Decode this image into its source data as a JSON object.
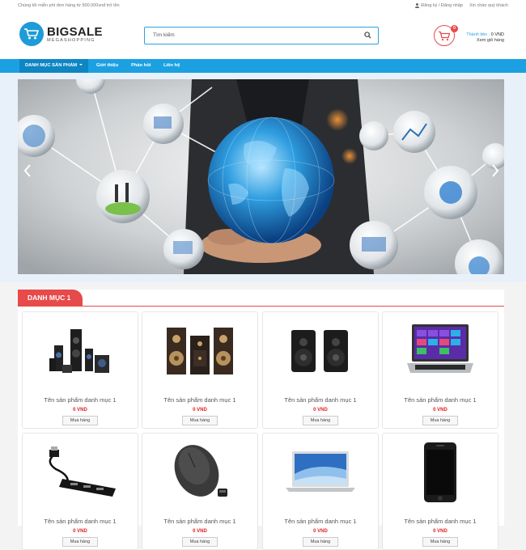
{
  "topbar": {
    "promo": "Chúng tôi miễn phí đơn hàng từ 500.000vnđ trở lên",
    "auth_link": "Đăng ký / Đăng nhập",
    "greeting": "Xin chào quý khách"
  },
  "header": {
    "logo_title": "BIGSALE",
    "logo_subtitle": "MEGASHOPPING",
    "search_placeholder": "Tìm kiếm",
    "cart_count": "0",
    "cart_total_label": "Thành tiền :",
    "cart_total_value": "0 VND",
    "view_cart": "Xem giỏ hàng"
  },
  "nav": {
    "items": [
      {
        "label": "DANH MỤC SẢN PHẨM"
      },
      {
        "label": "Giới thiệu"
      },
      {
        "label": "Phản hồi"
      },
      {
        "label": "Liên hệ"
      }
    ]
  },
  "category": {
    "title": "DANH MỤC 1",
    "products": [
      {
        "name": "Tên sản phẩm danh mục 1",
        "price": "0 VND",
        "buy": "Mua hàng",
        "icon": "speaker-system"
      },
      {
        "name": "Tên sản phẩm danh mục 1",
        "price": "0 VND",
        "buy": "Mua hàng",
        "icon": "bookshelf-speakers"
      },
      {
        "name": "Tên sản phẩm danh mục 1",
        "price": "0 VND",
        "buy": "Mua hàng",
        "icon": "desktop-speakers"
      },
      {
        "name": "Tên sản phẩm danh mục 1",
        "price": "0 VND",
        "buy": "Mua hàng",
        "icon": "laptop"
      },
      {
        "name": "Tên sản phẩm danh mục 1",
        "price": "0 VND",
        "buy": "Mua hàng",
        "icon": "usb-hub"
      },
      {
        "name": "Tên sản phẩm danh mục 1",
        "price": "0 VND",
        "buy": "Mua hàng",
        "icon": "mouse"
      },
      {
        "name": "Tên sản phẩm danh mục 1",
        "price": "0 VND",
        "buy": "Mua hàng",
        "icon": "macbook"
      },
      {
        "name": "Tên sản phẩm danh mục 1",
        "price": "0 VND",
        "buy": "Mua hàng",
        "icon": "smartphone"
      }
    ]
  },
  "colors": {
    "brand_blue": "#1ba0e2",
    "accent_red": "#e74a4a",
    "price_red": "#e02020"
  }
}
